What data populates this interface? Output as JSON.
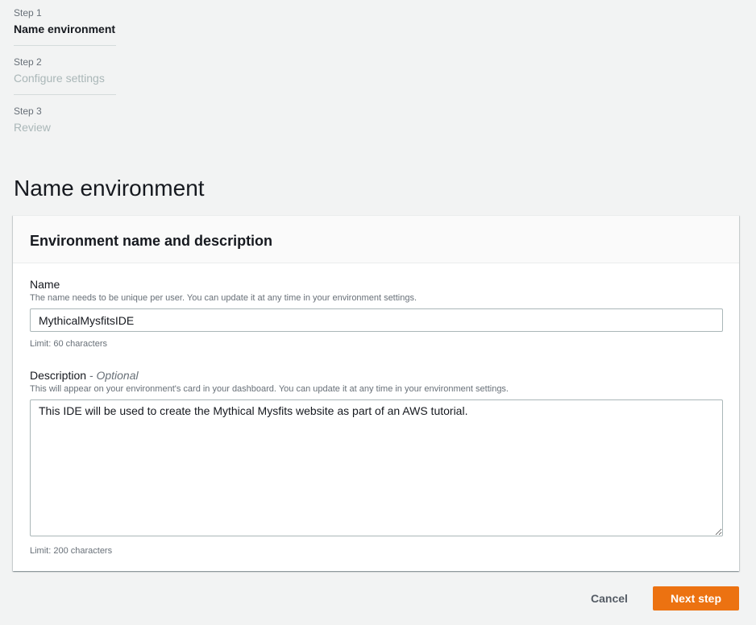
{
  "steps": [
    {
      "number": "Step 1",
      "title": "Name environment",
      "state": "active"
    },
    {
      "number": "Step 2",
      "title": "Configure settings",
      "state": "inactive"
    },
    {
      "number": "Step 3",
      "title": "Review",
      "state": "inactive"
    }
  ],
  "page_title": "Name environment",
  "panel": {
    "header": "Environment name and description",
    "name": {
      "label": "Name",
      "description": "The name needs to be unique per user. You can update it at any time in your environment settings.",
      "value": "MythicalMysfitsIDE",
      "limit": "Limit: 60 characters"
    },
    "description": {
      "label": "Description",
      "optional": "- Optional",
      "description": "This will appear on your environment's card in your dashboard. You can update it at any time in your environment settings.",
      "value": "This IDE will be used to create the Mythical Mysfits website as part of an AWS tutorial.",
      "limit": "Limit: 200 characters"
    }
  },
  "actions": {
    "cancel": "Cancel",
    "next": "Next step"
  },
  "colors": {
    "primary_button": "#ec7211",
    "background": "#f2f3f3"
  }
}
